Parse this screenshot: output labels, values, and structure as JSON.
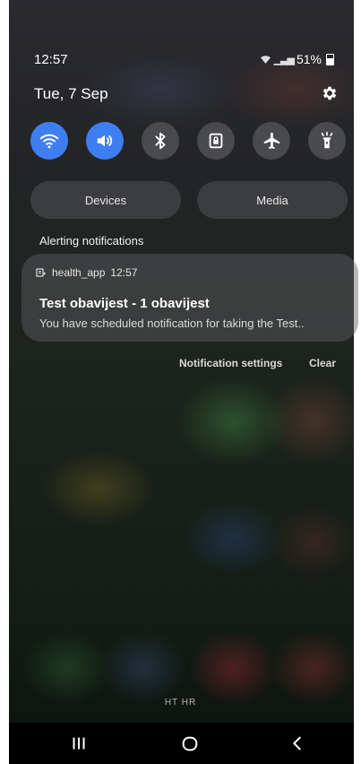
{
  "status_bar": {
    "time": "12:57",
    "battery_percent": "51%",
    "icons": [
      "wifi-icon",
      "signal-icon",
      "battery-icon"
    ]
  },
  "header": {
    "date": "Tue, 7 Sep",
    "settings_icon": "gear-icon"
  },
  "quick_toggles": [
    {
      "name": "wifi",
      "icon": "wifi-icon",
      "on": true
    },
    {
      "name": "sound",
      "icon": "speaker-icon",
      "on": true
    },
    {
      "name": "bluetooth",
      "icon": "bluetooth-icon",
      "on": false
    },
    {
      "name": "rotation-lock",
      "icon": "lock-rotate-icon",
      "on": false
    },
    {
      "name": "airplane",
      "icon": "airplane-icon",
      "on": false
    },
    {
      "name": "flashlight",
      "icon": "flashlight-icon",
      "on": false
    }
  ],
  "buttons": {
    "devices": "Devices",
    "media": "Media"
  },
  "section": {
    "title": "Alerting notifications"
  },
  "notification": {
    "app_name": "health_app",
    "time": "12:57",
    "title": "Test obavijest - 1 obavijest",
    "body": "You have scheduled notification for taking the Test.."
  },
  "actions": {
    "settings": "Notification settings",
    "clear": "Clear"
  },
  "carrier": "HT HR",
  "navigation": {
    "recents_icon": "recents-icon",
    "home_icon": "home-icon",
    "back_icon": "back-icon"
  },
  "colors": {
    "toggle_on": "#3e7ef0",
    "toggle_off": "#5a5a5e"
  }
}
